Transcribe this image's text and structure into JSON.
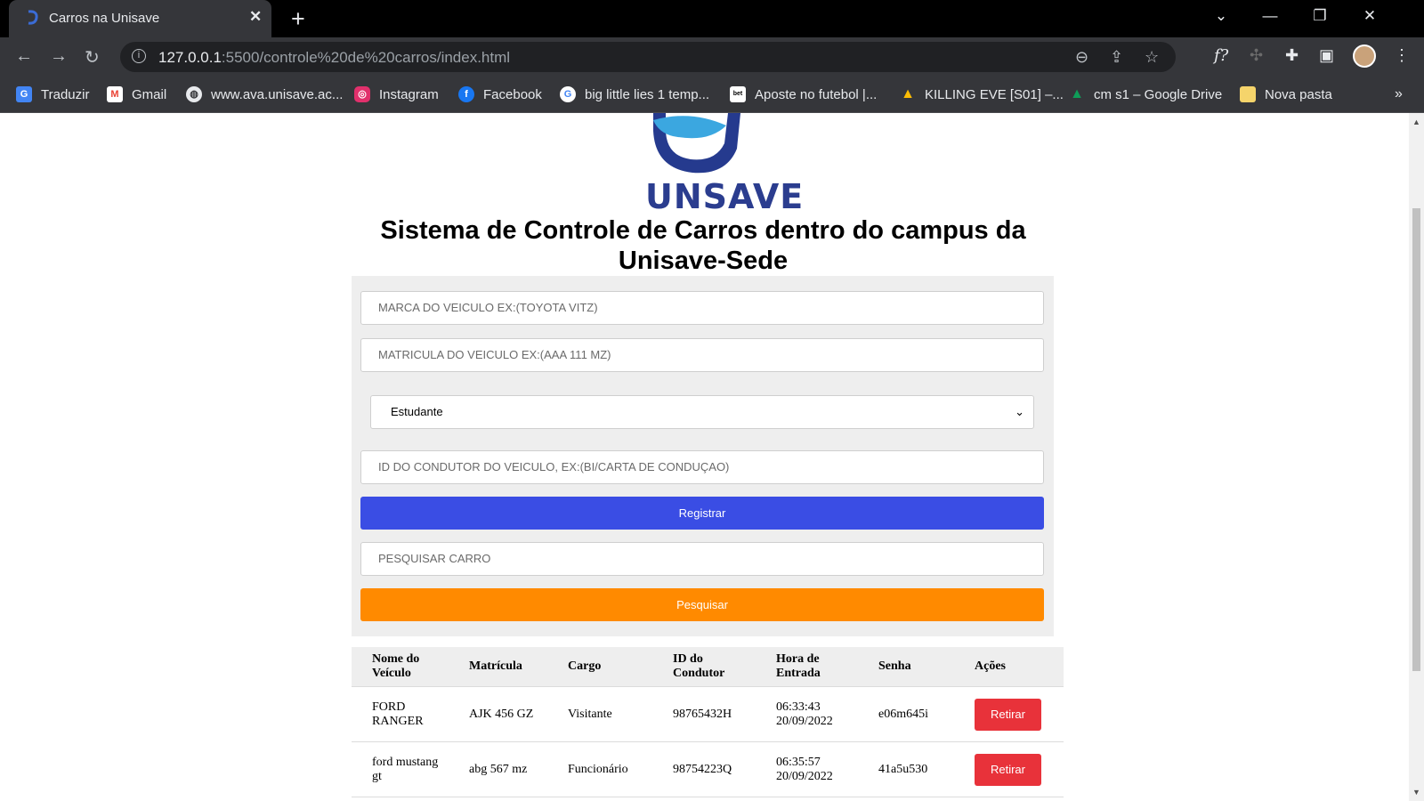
{
  "browser": {
    "tab_title": "Carros na Unisave",
    "url_host": "127.0.0.1",
    "url_rest": ":5500/controle%20de%20carros/index.html",
    "bookmarks": [
      {
        "label": "Traduzir",
        "icon": "google-translate-icon",
        "color": "#4285f4"
      },
      {
        "label": "Gmail",
        "icon": "gmail-icon",
        "color": "#ea4335"
      },
      {
        "label": "www.ava.unisave.ac...",
        "icon": "globe-icon",
        "color": "#e8eaed"
      },
      {
        "label": "Instagram",
        "icon": "instagram-icon",
        "color": "#e1306c"
      },
      {
        "label": "Facebook",
        "icon": "facebook-icon",
        "color": "#1877f2"
      },
      {
        "label": "big little lies 1 temp...",
        "icon": "google-icon",
        "color": "#ffffff"
      },
      {
        "label": "Aposte no futebol |...",
        "icon": "betway-icon",
        "color": "#ffffff"
      },
      {
        "label": "KILLING EVE [S01] –...",
        "icon": "google-drive-icon",
        "color": "#fbbc04"
      },
      {
        "label": "cm s1 – Google Drive",
        "icon": "google-drive-icon",
        "color": "#fbbc04"
      },
      {
        "label": "Nova pasta",
        "icon": "folder-icon",
        "color": "#f5d46b"
      }
    ]
  },
  "page": {
    "logo_text": "UNSAVE",
    "heading": "Sistema de Controle de Carros dentro do campus da Unisave-Sede",
    "form": {
      "brand_placeholder": "MARCA DO VEICULO EX:(TOYOTA VITZ)",
      "plate_placeholder": "MATRICULA DO VEICULO EX:(AAA 111 MZ)",
      "role_selected": "Estudante",
      "driver_id_placeholder": "ID DO CONDUTOR DO VEICULO, EX:(BI/CARTA DE CONDUÇAO)",
      "register_label": "Registrar",
      "search_placeholder": "PESQUISAR CARRO",
      "search_label": "Pesquisar"
    },
    "colors": {
      "register": "#3a4de4",
      "search": "#ff8a00",
      "remove": "#e8323a"
    },
    "table": {
      "headers": [
        "Nome do Veículo",
        "Matrícula",
        "Cargo",
        "ID do Condutor",
        "Hora de Entrada",
        "Senha",
        "Ações"
      ],
      "rows": [
        {
          "name": "FORD RANGER",
          "plate": "AJK 456 GZ",
          "role": "Visitante",
          "driver_id": "98765432H",
          "time": "06:33:43 20/09/2022",
          "password": "e06m645i",
          "action": "Retirar"
        },
        {
          "name": "ford mustang gt",
          "plate": "abg 567 mz",
          "role": "Funcionário",
          "driver_id": "98754223Q",
          "time": "06:35:57 20/09/2022",
          "password": "41a5u530",
          "action": "Retirar"
        }
      ]
    }
  }
}
